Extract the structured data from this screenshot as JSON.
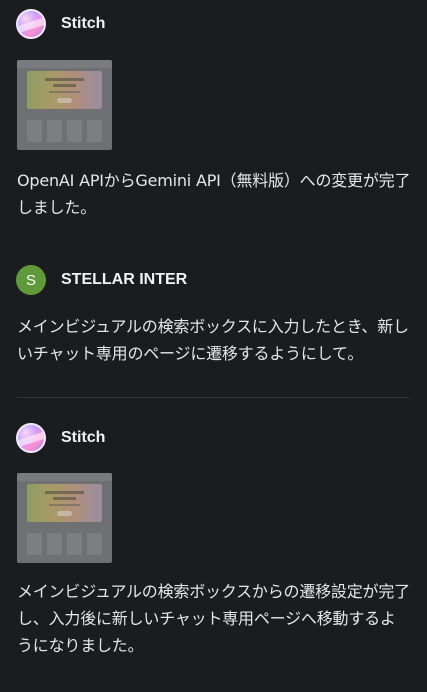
{
  "messages": [
    {
      "sender": "Stitch",
      "avatar_icon": "stitch-logo-icon",
      "has_thumbnail": true,
      "text": "OpenAI APIからGemini API（無料版）への変更が完了しました。"
    },
    {
      "sender": "STELLAR INTER",
      "avatar_initial": "S",
      "avatar_color": "#5f9a3a",
      "text": "メインビジュアルの検索ボックスに入力したとき、新しいチャット専用のページに遷移するようにして。"
    },
    {
      "sender": "Stitch",
      "avatar_icon": "stitch-logo-icon",
      "has_thumbnail": true,
      "text": "メインビジュアルの検索ボックスからの遷移設定が完了し、入力後に新しいチャット専用ページへ移動するようになりました。"
    }
  ],
  "colors": {
    "background": "#1b1c20",
    "text": "#e6e6e8",
    "divider": "#34353a"
  }
}
